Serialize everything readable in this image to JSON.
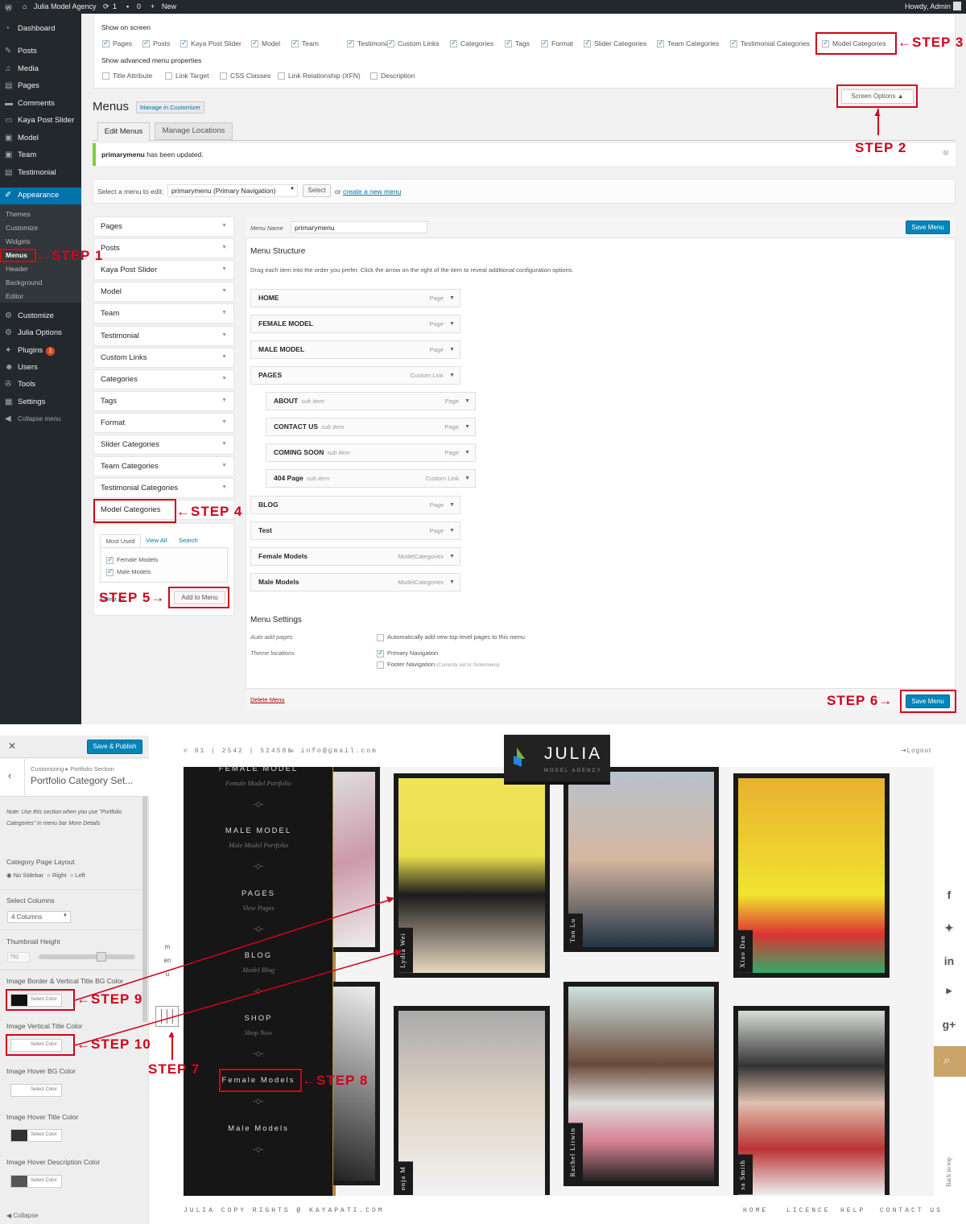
{
  "admin_bar": {
    "site": "Julia Model Agency",
    "updates": "1",
    "comments": "0",
    "new": "New",
    "howdy": "Howdy, Admin"
  },
  "admin_menu": {
    "items": [
      {
        "label": "Dashboard",
        "icon": "dashboard-icon"
      },
      {
        "label": "Posts",
        "icon": "pin-icon"
      },
      {
        "label": "Media",
        "icon": "media-icon"
      },
      {
        "label": "Pages",
        "icon": "page-icon"
      },
      {
        "label": "Comments",
        "icon": "comment-icon"
      },
      {
        "label": "Kaya Post Slider",
        "icon": "slider-icon"
      },
      {
        "label": "Model",
        "icon": "model-icon"
      },
      {
        "label": "Team",
        "icon": "team-icon"
      },
      {
        "label": "Testimonial",
        "icon": "testimonial-icon"
      },
      {
        "label": "Appearance",
        "icon": "brush-icon"
      }
    ],
    "sub": [
      "Themes",
      "Customize",
      "Widgets",
      "Menus",
      "Header",
      "Background",
      "Editor"
    ],
    "lower": [
      {
        "label": "Customize",
        "icon": "gear-icon"
      },
      {
        "label": "Julia Options",
        "icon": "gear-icon"
      },
      {
        "label": "Plugins",
        "icon": "plugin-icon",
        "badge": "1"
      },
      {
        "label": "Users",
        "icon": "users-icon"
      },
      {
        "label": "Tools",
        "icon": "wrench-icon"
      },
      {
        "label": "Settings",
        "icon": "settings-icon"
      },
      {
        "label": "Collapse menu",
        "icon": "collapse-icon"
      }
    ]
  },
  "screen_options": {
    "show_on_screen": "Show on screen",
    "checks": [
      "Pages",
      "Posts",
      "Kaya Post Slider",
      "Model",
      "Team",
      "Testimonial",
      "Custom Links",
      "Categories",
      "Tags",
      "Format",
      "Slider Categories",
      "Team Categories",
      "Testimonial Categories",
      "Model Categories"
    ],
    "advanced_title": "Show advanced menu properties",
    "advanced": [
      "Title Attribute",
      "Link Target",
      "CSS Classes",
      "Link Relationship (XFN)",
      "Description"
    ],
    "button": "Screen Options ▲"
  },
  "menus_page": {
    "title": "Menus",
    "manage_customizer": "Manage in Customizer",
    "tab_edit": "Edit Menus",
    "tab_locations": "Manage Locations",
    "notice_strong": "primarymenu",
    "notice_rest": " has been updated.",
    "select_label": "Select a menu to edit:",
    "select_value": "primarymenu (Primary Navigation)",
    "select_btn": "Select",
    "or": "or",
    "create_link": "create a new menu",
    "menu_name_label": "Menu Name",
    "menu_name_value": "primarymenu",
    "save_menu": "Save Menu",
    "structure_title": "Menu Structure",
    "structure_help": "Drag each item into the order you prefer. Click the arrow on the right of the item to reveal additional configuration options.",
    "settings_title": "Menu Settings",
    "auto_add_label": "Auto add pages",
    "auto_add_text": "Automatically add new top-level pages to this menu",
    "theme_loc_label": "Theme locations",
    "primary_nav": "Primary Navigation",
    "footer_nav": "Footer Navigation",
    "footer_note": "(Currently set to: footermenu)",
    "delete_menu": "Delete Menu"
  },
  "accordion": [
    "Pages",
    "Posts",
    "Kaya Post Slider",
    "Model",
    "Team",
    "Testimonial",
    "Custom Links",
    "Categories",
    "Tags",
    "Format",
    "Slider Categories",
    "Team Categories",
    "Testimonial Categories",
    "Model Categories"
  ],
  "cat_panel": {
    "tabs": [
      "Most Used",
      "View All",
      "Search"
    ],
    "items": [
      "Female Models",
      "Male Models"
    ],
    "select_all": "Select All",
    "add_btn": "Add to Menu"
  },
  "menu_items": [
    {
      "label": "HOME",
      "type": "Page",
      "sub": false,
      "subtext": ""
    },
    {
      "label": "FEMALE MODEL",
      "type": "Page",
      "sub": false,
      "subtext": ""
    },
    {
      "label": "MALE MODEL",
      "type": "Page",
      "sub": false,
      "subtext": ""
    },
    {
      "label": "PAGES",
      "type": "Custom Link",
      "sub": false,
      "subtext": ""
    },
    {
      "label": "ABOUT",
      "type": "Page",
      "sub": true,
      "subtext": "sub item"
    },
    {
      "label": "CONTACT US",
      "type": "Page",
      "sub": true,
      "subtext": "sub item"
    },
    {
      "label": "COMING SOON",
      "type": "Page",
      "sub": true,
      "subtext": "sub item"
    },
    {
      "label": "404 Page",
      "type": "Custom Link",
      "sub": true,
      "subtext": "sub item"
    },
    {
      "label": "BLOG",
      "type": "Page",
      "sub": false,
      "subtext": ""
    },
    {
      "label": "Test",
      "type": "Page",
      "sub": false,
      "subtext": ""
    },
    {
      "label": "Female Models",
      "type": "ModelCategories",
      "sub": false,
      "subtext": ""
    },
    {
      "label": "Male Models",
      "type": "ModelCategories",
      "sub": false,
      "subtext": ""
    }
  ],
  "steps": [
    "STEP 1",
    "STEP 2",
    "STEP 3",
    "STEP 4",
    "STEP 5",
    "STEP 6",
    "STEP 7",
    "STEP 8",
    "STEP 9",
    "STEP 10"
  ],
  "customizer": {
    "save_publish": "Save & Publish",
    "crumb": "Customizing ▸ Portfolio Section",
    "section_title": "Portfolio Category Set...",
    "note": "Note: Use this section when you use \"Portfolio Categories\" in menu bar More Details",
    "layout_label": "Category Page Layout",
    "layout_opts": [
      "No Sidebar",
      "Right",
      "Left"
    ],
    "columns_label": "Select Columns",
    "columns_value": "4 Columns",
    "thumb_label": "Thumbnail Height",
    "thumb_value": "792",
    "border_label": "Image Border & Vertical Title BG Color",
    "vtitle_label": "Image Vertical Title Color",
    "hover_bg_label": "Image Hover BG Color",
    "hover_title_label": "Image Hover Title Color",
    "hover_desc_label": "Image Hover Description Color",
    "select_color": "Select Color",
    "collapse": "Collapse"
  },
  "site": {
    "phone": "81 | 2542 | 524586",
    "email": "info@gmail.com",
    "logo": "JULIA",
    "logo_sub": "MODEL AGENCY",
    "logout": "Logout",
    "menu_word": "menu",
    "nav": [
      {
        "title": "FEMALE MODEL",
        "sub": "Female Model Portfolio"
      },
      {
        "title": "MALE MODEL",
        "sub": "Male Model Portfolio"
      },
      {
        "title": "PAGES",
        "sub": "View Pages"
      },
      {
        "title": "BLOG",
        "sub": "Model Blog"
      },
      {
        "title": "SHOP",
        "sub": "Shop Now"
      },
      {
        "title": "Female Models",
        "sub": ""
      },
      {
        "title": "Male Models",
        "sub": ""
      }
    ],
    "names": [
      "Lydia Wei",
      "Tan Lu",
      "Xiao Dan",
      "onja M",
      "Rachel Litwin",
      "sa Smith"
    ],
    "copyright": "JULIA COPY RIGHTS @ KAYAPATI.COM",
    "footer_links": [
      "HOME",
      "LICENCE",
      "HELP",
      "CONTACT US"
    ],
    "back_top": "Back to top"
  },
  "colors": {
    "wp_dark": "#23282d",
    "wp_blue": "#0073aa",
    "step_red": "#d0021b",
    "search_gold": "#c9a36a"
  }
}
